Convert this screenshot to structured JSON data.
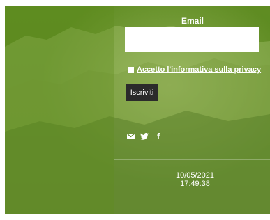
{
  "newsletter": {
    "email_label": "Email",
    "email_value": "",
    "privacy_label": "Accetto l'informativa sulla privacy",
    "privacy_checked": false,
    "submit_label": "Iscriviti"
  },
  "social": {
    "icons": [
      "mail-icon",
      "twitter-icon",
      "facebook-icon"
    ],
    "facebook_glyph": "f"
  },
  "timestamp": {
    "date": "10/05/2021",
    "time": "17:49:38"
  },
  "colors": {
    "background_green": "#5a8720",
    "button_dark": "#2b2b2b",
    "text": "#ffffff"
  }
}
